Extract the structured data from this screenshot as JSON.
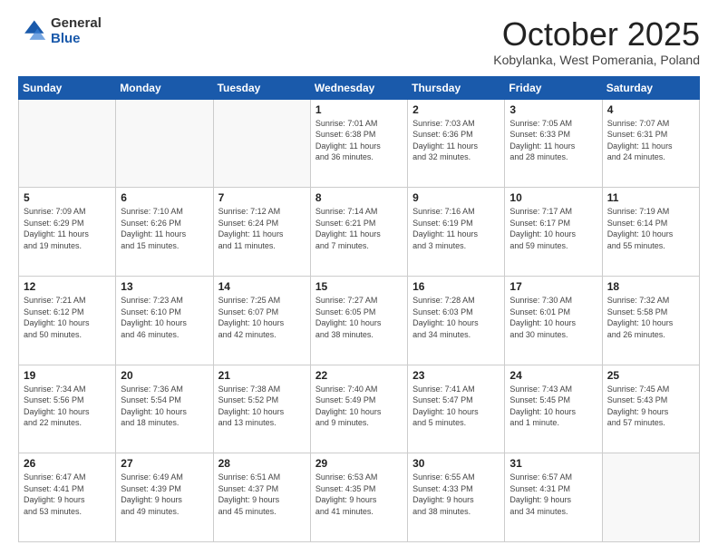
{
  "logo": {
    "general": "General",
    "blue": "Blue"
  },
  "header": {
    "month": "October 2025",
    "location": "Kobylanka, West Pomerania, Poland"
  },
  "weekdays": [
    "Sunday",
    "Monday",
    "Tuesday",
    "Wednesday",
    "Thursday",
    "Friday",
    "Saturday"
  ],
  "weeks": [
    [
      {
        "day": "",
        "info": ""
      },
      {
        "day": "",
        "info": ""
      },
      {
        "day": "",
        "info": ""
      },
      {
        "day": "1",
        "info": "Sunrise: 7:01 AM\nSunset: 6:38 PM\nDaylight: 11 hours\nand 36 minutes."
      },
      {
        "day": "2",
        "info": "Sunrise: 7:03 AM\nSunset: 6:36 PM\nDaylight: 11 hours\nand 32 minutes."
      },
      {
        "day": "3",
        "info": "Sunrise: 7:05 AM\nSunset: 6:33 PM\nDaylight: 11 hours\nand 28 minutes."
      },
      {
        "day": "4",
        "info": "Sunrise: 7:07 AM\nSunset: 6:31 PM\nDaylight: 11 hours\nand 24 minutes."
      }
    ],
    [
      {
        "day": "5",
        "info": "Sunrise: 7:09 AM\nSunset: 6:29 PM\nDaylight: 11 hours\nand 19 minutes."
      },
      {
        "day": "6",
        "info": "Sunrise: 7:10 AM\nSunset: 6:26 PM\nDaylight: 11 hours\nand 15 minutes."
      },
      {
        "day": "7",
        "info": "Sunrise: 7:12 AM\nSunset: 6:24 PM\nDaylight: 11 hours\nand 11 minutes."
      },
      {
        "day": "8",
        "info": "Sunrise: 7:14 AM\nSunset: 6:21 PM\nDaylight: 11 hours\nand 7 minutes."
      },
      {
        "day": "9",
        "info": "Sunrise: 7:16 AM\nSunset: 6:19 PM\nDaylight: 11 hours\nand 3 minutes."
      },
      {
        "day": "10",
        "info": "Sunrise: 7:17 AM\nSunset: 6:17 PM\nDaylight: 10 hours\nand 59 minutes."
      },
      {
        "day": "11",
        "info": "Sunrise: 7:19 AM\nSunset: 6:14 PM\nDaylight: 10 hours\nand 55 minutes."
      }
    ],
    [
      {
        "day": "12",
        "info": "Sunrise: 7:21 AM\nSunset: 6:12 PM\nDaylight: 10 hours\nand 50 minutes."
      },
      {
        "day": "13",
        "info": "Sunrise: 7:23 AM\nSunset: 6:10 PM\nDaylight: 10 hours\nand 46 minutes."
      },
      {
        "day": "14",
        "info": "Sunrise: 7:25 AM\nSunset: 6:07 PM\nDaylight: 10 hours\nand 42 minutes."
      },
      {
        "day": "15",
        "info": "Sunrise: 7:27 AM\nSunset: 6:05 PM\nDaylight: 10 hours\nand 38 minutes."
      },
      {
        "day": "16",
        "info": "Sunrise: 7:28 AM\nSunset: 6:03 PM\nDaylight: 10 hours\nand 34 minutes."
      },
      {
        "day": "17",
        "info": "Sunrise: 7:30 AM\nSunset: 6:01 PM\nDaylight: 10 hours\nand 30 minutes."
      },
      {
        "day": "18",
        "info": "Sunrise: 7:32 AM\nSunset: 5:58 PM\nDaylight: 10 hours\nand 26 minutes."
      }
    ],
    [
      {
        "day": "19",
        "info": "Sunrise: 7:34 AM\nSunset: 5:56 PM\nDaylight: 10 hours\nand 22 minutes."
      },
      {
        "day": "20",
        "info": "Sunrise: 7:36 AM\nSunset: 5:54 PM\nDaylight: 10 hours\nand 18 minutes."
      },
      {
        "day": "21",
        "info": "Sunrise: 7:38 AM\nSunset: 5:52 PM\nDaylight: 10 hours\nand 13 minutes."
      },
      {
        "day": "22",
        "info": "Sunrise: 7:40 AM\nSunset: 5:49 PM\nDaylight: 10 hours\nand 9 minutes."
      },
      {
        "day": "23",
        "info": "Sunrise: 7:41 AM\nSunset: 5:47 PM\nDaylight: 10 hours\nand 5 minutes."
      },
      {
        "day": "24",
        "info": "Sunrise: 7:43 AM\nSunset: 5:45 PM\nDaylight: 10 hours\nand 1 minute."
      },
      {
        "day": "25",
        "info": "Sunrise: 7:45 AM\nSunset: 5:43 PM\nDaylight: 9 hours\nand 57 minutes."
      }
    ],
    [
      {
        "day": "26",
        "info": "Sunrise: 6:47 AM\nSunset: 4:41 PM\nDaylight: 9 hours\nand 53 minutes."
      },
      {
        "day": "27",
        "info": "Sunrise: 6:49 AM\nSunset: 4:39 PM\nDaylight: 9 hours\nand 49 minutes."
      },
      {
        "day": "28",
        "info": "Sunrise: 6:51 AM\nSunset: 4:37 PM\nDaylight: 9 hours\nand 45 minutes."
      },
      {
        "day": "29",
        "info": "Sunrise: 6:53 AM\nSunset: 4:35 PM\nDaylight: 9 hours\nand 41 minutes."
      },
      {
        "day": "30",
        "info": "Sunrise: 6:55 AM\nSunset: 4:33 PM\nDaylight: 9 hours\nand 38 minutes."
      },
      {
        "day": "31",
        "info": "Sunrise: 6:57 AM\nSunset: 4:31 PM\nDaylight: 9 hours\nand 34 minutes."
      },
      {
        "day": "",
        "info": ""
      }
    ]
  ]
}
